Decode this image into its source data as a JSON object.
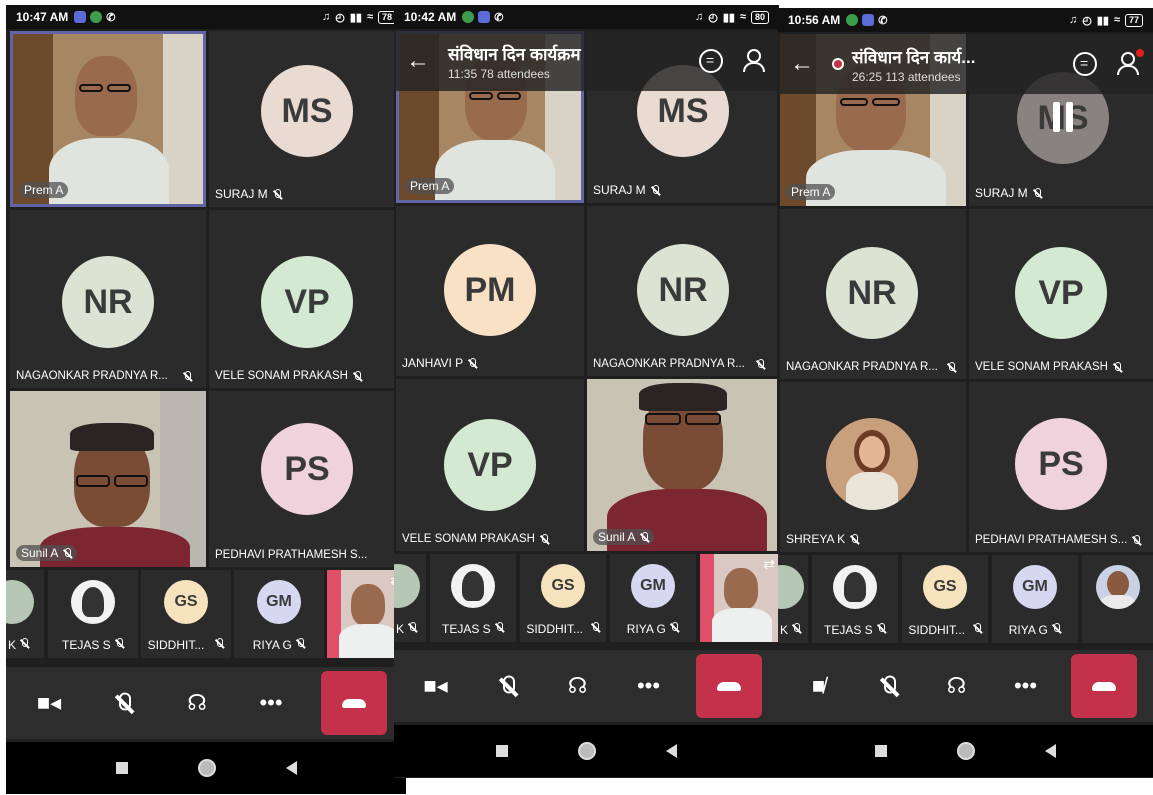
{
  "colors": {
    "selected_border": "#6264a7",
    "hangup": "#c4314b",
    "avatar_ms": "#e9dbd2",
    "avatar_nr": "#dde3d3",
    "avatar_vp": "#d4e9d2",
    "avatar_ps": "#efd2dc",
    "avatar_pm": "#f9e1c6",
    "avatar_gs": "#f6e2bd",
    "avatar_gm": "#d6d8f1"
  },
  "icons": {
    "video": "video-camera-icon",
    "mic": "mic-off-icon",
    "audio": "headset-icon",
    "more": "more-dots-icon",
    "hangup": "hang-up-phone-icon",
    "chat": "chat-icon",
    "people": "people-icon",
    "back": "back-arrow-icon"
  },
  "screen1": {
    "status_time": "10:47 AM",
    "battery": "78",
    "tiles": {
      "prem": "Prem A",
      "suraj_initials": "MS",
      "suraj": "SURAJ M",
      "nagaonkar_initials": "NR",
      "nagaonkar": "NAGAONKAR PRADNYA R...",
      "vele_initials": "VP",
      "vele": "VELE SONAM PRAKASH",
      "sunil": "Sunil A",
      "pedhavi_initials": "PS",
      "pedhavi": "PEDHAVI PRATHAMESH S..."
    },
    "strip": {
      "k": "K",
      "tejas": "TEJAS S",
      "gs_initials": "GS",
      "siddhit": "SIDDHIT...",
      "gm_initials": "GM",
      "riya": "RIYA G"
    }
  },
  "screen2": {
    "status_time": "10:42 AM",
    "battery": "80",
    "header": {
      "back": "←",
      "title": "संविधान दिन कार्यक्रम",
      "subtitle": "11:35  78 attendees"
    },
    "tiles": {
      "prem": "Prem A",
      "suraj_initials": "MS",
      "suraj": "SURAJ M",
      "janhavi_initials": "PM",
      "janhavi": "JANHAVI P",
      "nagaonkar_initials": "NR",
      "nagaonkar": "NAGAONKAR PRADNYA R...",
      "vele_initials": "VP",
      "vele": "VELE SONAM PRAKASH",
      "sunil": "Sunil A"
    },
    "strip": {
      "k": "K",
      "tejas": "TEJAS S",
      "gs_initials": "GS",
      "siddhit": "SIDDHIT...",
      "gm_initials": "GM",
      "riya": "RIYA G"
    }
  },
  "screen3": {
    "status_time": "10:56 AM",
    "battery": "77",
    "header": {
      "back": "←",
      "title": "संविधान दिन कार्य...",
      "subtitle": "26:25  113 attendees"
    },
    "tiles": {
      "prem": "Prem A",
      "suraj_initials": "MS",
      "suraj": "SURAJ M",
      "nagaonkar_initials": "NR",
      "nagaonkar": "NAGAONKAR PRADNYA R...",
      "vele_initials": "VP",
      "vele": "VELE SONAM PRAKASH",
      "shreya": "SHREYA K",
      "pedhavi_initials": "PS",
      "pedhavi": "PEDHAVI PRATHAMESH S..."
    },
    "strip": {
      "k": "K",
      "tejas": "TEJAS S",
      "gs_initials": "GS",
      "siddhit": "SIDDHIT...",
      "gm_initials": "GM",
      "riya": "RIYA G"
    }
  }
}
